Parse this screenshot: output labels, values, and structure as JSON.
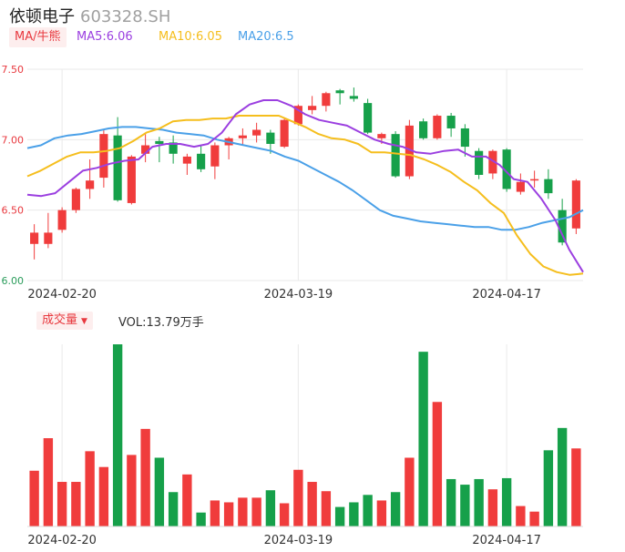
{
  "header": {
    "name": "依顿电子",
    "code": "603328.SH"
  },
  "ma_button": "MA/牛熊",
  "ma_legend": [
    {
      "label": "MA5:6.06",
      "color": "#9b3fe0"
    },
    {
      "label": "MA10:6.05",
      "color": "#f5be1d"
    },
    {
      "label": "MA20:6.5",
      "color": "#4aa0e8"
    }
  ],
  "volume_panel": {
    "button": "成交量",
    "caret": "▼",
    "label": "VOL:13.79万手"
  },
  "colors": {
    "up": "#f03c3c",
    "down": "#16a04a",
    "grid": "#eaeaea"
  },
  "chart_data": [
    {
      "type": "candlestick",
      "ylim": [
        6.0,
        7.5
      ],
      "y_ticks": [
        "7.50",
        "7.00",
        "6.50",
        "6.00"
      ],
      "x_tick_labels": [
        {
          "index": 2,
          "label": "2024-02-20"
        },
        {
          "index": 19,
          "label": "2024-03-19"
        },
        {
          "index": 34,
          "label": "2024-04-17"
        }
      ],
      "ohlc": [
        [
          6.26,
          6.34,
          6.15,
          6.4
        ],
        [
          6.26,
          6.34,
          6.23,
          6.48
        ],
        [
          6.36,
          6.5,
          6.34,
          6.52
        ],
        [
          6.5,
          6.65,
          6.48,
          6.66
        ],
        [
          6.65,
          6.71,
          6.58,
          6.86
        ],
        [
          6.73,
          7.04,
          6.66,
          7.07
        ],
        [
          7.03,
          6.57,
          6.56,
          7.16
        ],
        [
          6.55,
          6.88,
          6.54,
          6.89
        ],
        [
          6.9,
          6.96,
          6.84,
          7.05
        ],
        [
          6.99,
          6.97,
          6.84,
          7.02
        ],
        [
          6.98,
          6.9,
          6.83,
          7.03
        ],
        [
          6.83,
          6.88,
          6.75,
          6.9
        ],
        [
          6.9,
          6.79,
          6.77,
          6.96
        ],
        [
          6.81,
          6.96,
          6.72,
          6.98
        ],
        [
          6.96,
          7.01,
          6.86,
          7.02
        ],
        [
          7.01,
          7.03,
          6.96,
          7.08
        ],
        [
          7.03,
          7.07,
          6.98,
          7.12
        ],
        [
          7.05,
          6.97,
          6.9,
          7.07
        ],
        [
          6.95,
          7.14,
          6.94,
          7.15
        ],
        [
          7.11,
          7.24,
          7.1,
          7.25
        ],
        [
          7.21,
          7.24,
          7.18,
          7.31
        ],
        [
          7.24,
          7.33,
          7.2,
          7.34
        ],
        [
          7.35,
          7.33,
          7.25,
          7.36
        ],
        [
          7.31,
          7.29,
          7.27,
          7.37
        ],
        [
          7.26,
          7.05,
          7.04,
          7.29
        ],
        [
          7.01,
          7.04,
          6.97,
          7.05
        ],
        [
          7.04,
          6.74,
          6.73,
          7.06
        ],
        [
          6.74,
          7.1,
          6.72,
          7.14
        ],
        [
          7.13,
          7.01,
          7.0,
          7.15
        ],
        [
          7.01,
          7.17,
          7.0,
          7.18
        ],
        [
          7.17,
          7.08,
          7.02,
          7.19
        ],
        [
          7.08,
          6.95,
          6.88,
          7.11
        ],
        [
          6.92,
          6.75,
          6.72,
          6.94
        ],
        [
          6.76,
          6.92,
          6.72,
          6.93
        ],
        [
          6.93,
          6.65,
          6.63,
          6.94
        ],
        [
          6.63,
          6.7,
          6.61,
          6.76
        ],
        [
          6.71,
          6.72,
          6.66,
          6.78
        ],
        [
          6.72,
          6.62,
          6.58,
          6.79
        ],
        [
          6.5,
          6.27,
          6.25,
          6.58
        ],
        [
          6.37,
          6.71,
          6.33,
          6.72
        ]
      ],
      "ma5": [
        6.61,
        6.6,
        6.62,
        6.7,
        6.78,
        6.8,
        6.83,
        6.85,
        6.86,
        6.95,
        6.97,
        6.97,
        6.95,
        6.97,
        7.05,
        7.18,
        7.25,
        7.28,
        7.28,
        7.24,
        7.18,
        7.14,
        7.12,
        7.1,
        7.05,
        7.0,
        6.97,
        6.95,
        6.91,
        6.9,
        6.92,
        6.93,
        6.88,
        6.88,
        6.82,
        6.72,
        6.7,
        6.58,
        6.43,
        6.22,
        6.06
      ],
      "ma10": [
        6.74,
        6.78,
        6.83,
        6.88,
        6.91,
        6.91,
        6.92,
        6.94,
        6.99,
        7.05,
        7.08,
        7.13,
        7.14,
        7.14,
        7.15,
        7.15,
        7.17,
        7.17,
        7.17,
        7.17,
        7.13,
        7.09,
        7.04,
        7.01,
        7.0,
        6.97,
        6.91,
        6.91,
        6.9,
        6.89,
        6.86,
        6.82,
        6.77,
        6.7,
        6.64,
        6.55,
        6.48,
        6.32,
        6.19,
        6.1,
        6.06,
        6.04,
        6.05
      ],
      "ma20": [
        6.94,
        6.96,
        7.01,
        7.03,
        7.04,
        7.06,
        7.08,
        7.09,
        7.09,
        7.08,
        7.07,
        7.05,
        7.04,
        7.03,
        7.0,
        6.98,
        6.96,
        6.94,
        6.92,
        6.88,
        6.85,
        6.8,
        6.75,
        6.7,
        6.64,
        6.57,
        6.5,
        6.46,
        6.44,
        6.42,
        6.41,
        6.4,
        6.39,
        6.38,
        6.38,
        6.36,
        6.36,
        6.38,
        6.41,
        6.43,
        6.45,
        6.5
      ]
    },
    {
      "type": "bar",
      "title": "成交量",
      "value_label": "VOL:13.79万手",
      "values": [
        6.0,
        9.5,
        4.8,
        4.8,
        8.1,
        6.4,
        19.6,
        7.7,
        10.5,
        7.4,
        3.7,
        5.6,
        1.5,
        2.8,
        2.6,
        3.1,
        3.1,
        3.9,
        2.5,
        6.1,
        4.8,
        3.8,
        2.1,
        2.6,
        3.4,
        2.8,
        3.7,
        7.4,
        18.8,
        13.4,
        5.1,
        4.5,
        5.1,
        4.0,
        5.2,
        2.2,
        1.6,
        8.2,
        10.6,
        8.4
      ],
      "x_tick_labels": [
        {
          "index": 2,
          "label": "2024-02-20"
        },
        {
          "index": 19,
          "label": "2024-03-19"
        },
        {
          "index": 34,
          "label": "2024-04-17"
        }
      ]
    }
  ]
}
